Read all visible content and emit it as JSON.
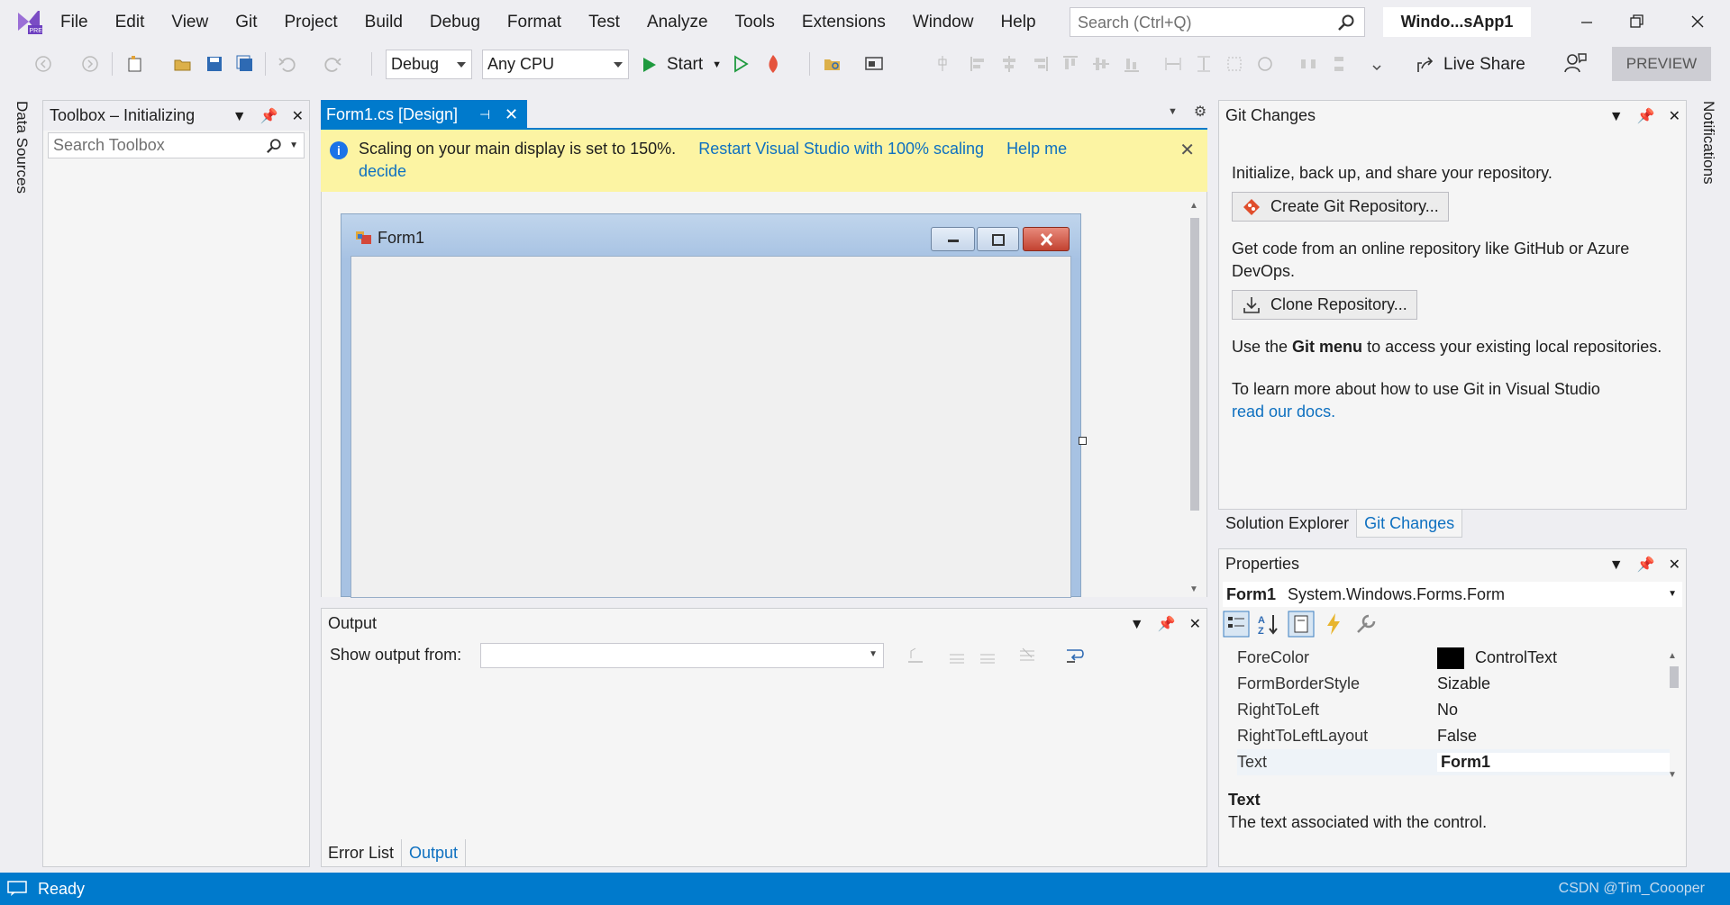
{
  "menubar": {
    "items": [
      "File",
      "Edit",
      "View",
      "Git",
      "Project",
      "Build",
      "Debug",
      "Format",
      "Test",
      "Analyze",
      "Tools",
      "Extensions",
      "Window",
      "Help"
    ],
    "search_placeholder": "Search (Ctrl+Q)",
    "solution_name": "Windo...sApp1"
  },
  "toolbar": {
    "configuration": "Debug",
    "platform": "Any CPU",
    "start_label": "Start",
    "live_share_label": "Live Share",
    "preview_label": "PREVIEW"
  },
  "left_strip": {
    "tab": "Data Sources"
  },
  "toolbox": {
    "title": "Toolbox – Initializing",
    "search_placeholder": "Search Toolbox"
  },
  "document": {
    "tab_label": "Form1.cs [Design]",
    "infobar": {
      "message": "Scaling on your main display is set to 150%.",
      "action_link": "Restart Visual Studio with 100% scaling",
      "help_link_1": "Help me",
      "help_link_2": "decide"
    },
    "form_title": "Form1"
  },
  "output": {
    "title": "Output",
    "show_from_label": "Show output from:",
    "source_value": ""
  },
  "bottom_tabs": [
    "Error List",
    "Output"
  ],
  "git": {
    "title": "Git Changes",
    "intro": "Initialize, back up, and share your repository.",
    "create_button": "Create Git Repository...",
    "online_text": "Get code from an online repository like GitHub or Azure DevOps.",
    "clone_button": "Clone Repository...",
    "menu_text_pre": "Use the ",
    "menu_text_bold": "Git menu",
    "menu_text_post": " to access your existing local repositories.",
    "learn_text": "To learn more about how to use Git in Visual Studio",
    "docs_link": "read our docs."
  },
  "right_tabs": [
    "Solution Explorer",
    "Git Changes"
  ],
  "properties": {
    "title": "Properties",
    "object_name": "Form1",
    "object_type": "System.Windows.Forms.Form",
    "rows": [
      {
        "name": "ForeColor",
        "value": "ControlText",
        "swatch": "#000000"
      },
      {
        "name": "FormBorderStyle",
        "value": "Sizable"
      },
      {
        "name": "RightToLeft",
        "value": "No"
      },
      {
        "name": "RightToLeftLayout",
        "value": "False"
      },
      {
        "name": "Text",
        "value": "Form1"
      }
    ],
    "desc_title": "Text",
    "desc_text": "The text associated with the control."
  },
  "right_strip": {
    "tab": "Notifications"
  },
  "statusbar": {
    "status": "Ready",
    "watermark": "CSDN @Tim_Coooper"
  },
  "colors": {
    "accent": "#007acc",
    "infobar": "#fcf4a3",
    "link": "#0e70c0"
  }
}
